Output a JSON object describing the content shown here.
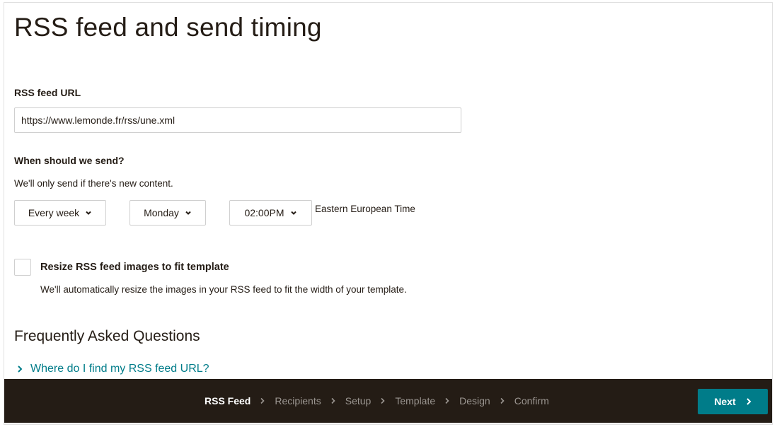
{
  "page": {
    "title": "RSS feed and send timing"
  },
  "rss": {
    "url_label": "RSS feed URL",
    "url_value": "https://www.lemonde.fr/rss/une.xml"
  },
  "schedule": {
    "heading": "When should we send?",
    "help": "We'll only send if there's new content.",
    "frequency": "Every week",
    "day": "Monday",
    "time": "02:00PM",
    "timezone": "Eastern European Time"
  },
  "resize": {
    "label": "Resize RSS feed images to fit template",
    "description": "We'll automatically resize the images in your RSS feed to fit the width of your template.",
    "checked": false
  },
  "faq": {
    "title": "Frequently Asked Questions",
    "items": [
      {
        "label": "Where do I find my RSS feed URL?"
      }
    ]
  },
  "wizard": {
    "steps": [
      {
        "label": "RSS Feed",
        "active": true
      },
      {
        "label": "Recipients",
        "active": false
      },
      {
        "label": "Setup",
        "active": false
      },
      {
        "label": "Template",
        "active": false
      },
      {
        "label": "Design",
        "active": false
      },
      {
        "label": "Confirm",
        "active": false
      }
    ],
    "next_label": "Next"
  },
  "colors": {
    "text": "#241c15",
    "link": "#007c89",
    "primary_button": "#007c89",
    "footer_bg": "#241c15",
    "inactive_step": "#9b9691"
  },
  "icons": {
    "dropdown": "chevron-down-icon",
    "faq_expand": "chevron-right-icon",
    "step_separator": "chevron-right-icon",
    "next": "chevron-right-icon"
  }
}
